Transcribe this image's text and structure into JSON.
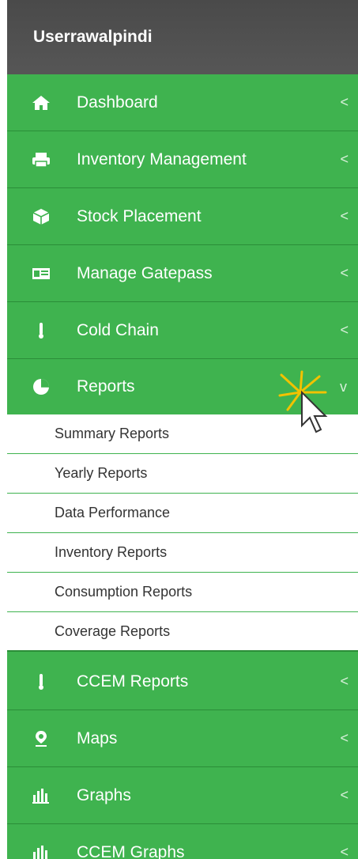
{
  "sidebar": {
    "user": "Userrawalpindi",
    "items": [
      {
        "label": "Dashboard",
        "icon": "home-icon",
        "chevron": "<"
      },
      {
        "label": "Inventory Management",
        "icon": "printer-icon",
        "chevron": "<"
      },
      {
        "label": "Stock Placement",
        "icon": "cube-icon",
        "chevron": "<"
      },
      {
        "label": "Manage Gatepass",
        "icon": "id-card-icon",
        "chevron": "<"
      },
      {
        "label": "Cold Chain",
        "icon": "thermometer-icon",
        "chevron": "<"
      },
      {
        "label": "Reports",
        "icon": "pie-chart-icon",
        "chevron": "v",
        "expanded": true
      },
      {
        "label": "CCEM Reports",
        "icon": "thermometer-icon",
        "chevron": "<"
      },
      {
        "label": "Maps",
        "icon": "map-marker-icon",
        "chevron": "<"
      },
      {
        "label": "Graphs",
        "icon": "bar-chart-icon",
        "chevron": "<"
      },
      {
        "label": "CCEM Graphs",
        "icon": "bar-chart-icon",
        "chevron": "<"
      }
    ],
    "reports_submenu": [
      "Summary Reports",
      "Yearly Reports",
      "Data Performance",
      "Inventory Reports",
      "Consumption Reports",
      "Coverage Reports"
    ]
  },
  "colors": {
    "menu_green": "#3fb34f",
    "header_gray": "#505050",
    "submenu_bg": "#ffffff",
    "submenu_text": "#333333"
  }
}
